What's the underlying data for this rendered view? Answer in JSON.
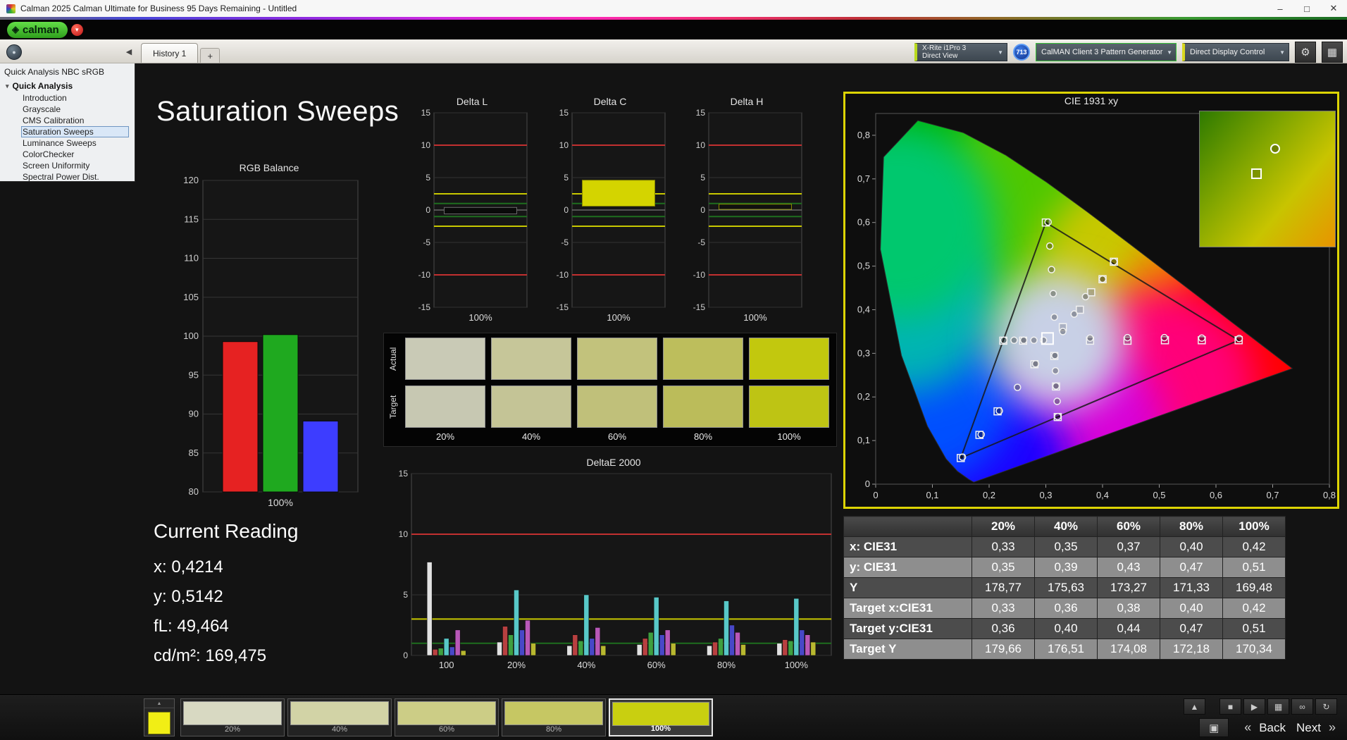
{
  "title_bar": {
    "title": "Calman 2025 Calman Ultimate for Business 95 Days Remaining  - Untitled",
    "minimize": "–",
    "maximize": "□",
    "close": "✕"
  },
  "toolbar": {
    "logo_text": "calman",
    "logo_icon": "◈",
    "logo_caret": "▾"
  },
  "tab_bar": {
    "tabs": [
      {
        "label": "History 1"
      }
    ],
    "add_tab": "+",
    "collapse_icon": "◀",
    "nav_icon": "●",
    "badge": "713",
    "devices": [
      {
        "line1": "X-Rite i1Pro 3",
        "line2": "Direct View"
      },
      {
        "line1": "CalMAN Client 3 Pattern Generator",
        "line2": ""
      },
      {
        "line1": "Direct Display Control",
        "line2": ""
      }
    ],
    "caret": "▼",
    "gear_icon": "⚙",
    "grid_icon": "▦"
  },
  "sidebar": {
    "header": "Quick Analysis NBC sRGB",
    "root": "Quick Analysis",
    "selected_index": 3,
    "items": [
      {
        "label": "Introduction"
      },
      {
        "label": "Grayscale"
      },
      {
        "label": "CMS Calibration"
      },
      {
        "label": "Saturation Sweeps"
      },
      {
        "label": "Luminance Sweeps"
      },
      {
        "label": "ColorChecker"
      },
      {
        "label": "Screen Uniformity"
      },
      {
        "label": "Spectral Power Dist."
      }
    ]
  },
  "page_title": "Saturation Sweeps",
  "current_reading": {
    "title": "Current Reading",
    "lines": [
      "x: 0,4214",
      "y: 0,5142",
      "fL: 49,464",
      "cd/m²: 169,475"
    ]
  },
  "swatch_panel": {
    "row_labels": [
      "Actual",
      "Target"
    ],
    "col_labels": [
      "20%",
      "40%",
      "60%",
      "80%",
      "100%"
    ],
    "actual": [
      "#c9cab6",
      "#c6c699",
      "#c2c27c",
      "#bdbe5c",
      "#c2c80e"
    ],
    "target": [
      "#c7c8b2",
      "#c4c496",
      "#c0c07a",
      "#bbbc5a",
      "#bec414"
    ]
  },
  "chart_data": {
    "rgb_balance": {
      "type": "bar",
      "title": "RGB Balance",
      "categories": [
        "Red",
        "Green",
        "Blue"
      ],
      "values": [
        99.3,
        100.2,
        89.1
      ],
      "colors": [
        "#e62222",
        "#1fa91f",
        "#3d3dff"
      ],
      "ylim": [
        80,
        120
      ],
      "ytick": 5,
      "xlabel": "100%"
    },
    "delta_l": {
      "type": "range-bar",
      "title": "Delta L",
      "ylim": [
        -15,
        15
      ],
      "ytick": 5,
      "xlabel": "100%",
      "bar": {
        "from": -0.6,
        "to": 0.4,
        "color": "#0a0a0a",
        "stroke": "#6a6a6a"
      },
      "ref_lines": [
        {
          "y": 10,
          "color": "#c23030"
        },
        {
          "y": -10,
          "color": "#c23030"
        },
        {
          "y": 2.5,
          "color": "#c8c800"
        },
        {
          "y": -2.5,
          "color": "#c8c800"
        },
        {
          "y": 1,
          "color": "#1e6e1e"
        },
        {
          "y": -1,
          "color": "#1e6e1e"
        }
      ]
    },
    "delta_c": {
      "type": "range-bar",
      "title": "Delta C",
      "ylim": [
        -15,
        15
      ],
      "ytick": 5,
      "xlabel": "100%",
      "bar": {
        "from": 0.6,
        "to": 4.6,
        "color": "#d4d400",
        "stroke": "#8a8a00"
      },
      "ref_lines": [
        {
          "y": 10,
          "color": "#c23030"
        },
        {
          "y": -10,
          "color": "#c23030"
        },
        {
          "y": 2.5,
          "color": "#c8c800"
        },
        {
          "y": -2.5,
          "color": "#c8c800"
        },
        {
          "y": 1,
          "color": "#1e6e1e"
        },
        {
          "y": -1,
          "color": "#1e6e1e"
        }
      ]
    },
    "delta_h": {
      "type": "range-bar",
      "title": "Delta H",
      "ylim": [
        -15,
        15
      ],
      "ytick": 5,
      "xlabel": "100%",
      "bar": {
        "from": 0.1,
        "to": 0.9,
        "color": "#101010",
        "stroke": "#8a8a00"
      },
      "ref_lines": [
        {
          "y": 10,
          "color": "#c23030"
        },
        {
          "y": -10,
          "color": "#c23030"
        },
        {
          "y": 2.5,
          "color": "#c8c800"
        },
        {
          "y": -2.5,
          "color": "#c8c800"
        },
        {
          "y": 1,
          "color": "#1e6e1e"
        },
        {
          "y": -1,
          "color": "#1e6e1e"
        }
      ]
    },
    "deltae2000": {
      "type": "grouped-bar",
      "title": "DeltaE 2000",
      "categories": [
        "100",
        "20%",
        "40%",
        "60%",
        "80%",
        "100%"
      ],
      "ylim": [
        0,
        15
      ],
      "ytick": 5,
      "ref_lines": [
        {
          "y": 10,
          "color": "#c23030"
        },
        {
          "y": 3,
          "color": "#c8c800"
        },
        {
          "y": 1,
          "color": "#1e6e1e"
        }
      ],
      "series": [
        {
          "name": "white",
          "color": "#e2e2e2",
          "values": [
            7.7,
            1.1,
            0.8,
            0.9,
            0.8,
            1.0
          ]
        },
        {
          "name": "red",
          "color": "#b84040",
          "values": [
            0.5,
            2.4,
            1.7,
            1.4,
            1.1,
            1.3
          ]
        },
        {
          "name": "green",
          "color": "#3f9f3f",
          "values": [
            0.6,
            1.7,
            1.2,
            1.9,
            1.4,
            1.2
          ]
        },
        {
          "name": "teal",
          "color": "#58c8c8",
          "values": [
            1.4,
            5.4,
            5.0,
            4.8,
            4.5,
            4.7
          ]
        },
        {
          "name": "blue",
          "color": "#4848c8",
          "values": [
            0.7,
            2.1,
            1.4,
            1.7,
            2.5,
            2.1
          ]
        },
        {
          "name": "magenta",
          "color": "#b858b8",
          "values": [
            2.1,
            2.9,
            2.3,
            2.1,
            1.9,
            1.7
          ]
        },
        {
          "name": "yellow",
          "color": "#b8b830",
          "values": [
            0.4,
            1.0,
            0.8,
            1.0,
            0.9,
            1.1
          ]
        }
      ]
    },
    "cie": {
      "type": "scatter",
      "title": "CIE 1931 xy",
      "xlim": [
        0,
        0.8
      ],
      "ylim": [
        0,
        0.85
      ],
      "gamut_triangle": [
        [
          0.64,
          0.33
        ],
        [
          0.3,
          0.6
        ],
        [
          0.15,
          0.06
        ]
      ],
      "current_point": [
        0.303,
        0.334
      ],
      "measured_points": [
        [
          0.378,
          0.335
        ],
        [
          0.444,
          0.336
        ],
        [
          0.509,
          0.336
        ],
        [
          0.575,
          0.335
        ],
        [
          0.641,
          0.334
        ],
        [
          0.315,
          0.383
        ],
        [
          0.313,
          0.437
        ],
        [
          0.31,
          0.492
        ],
        [
          0.307,
          0.546
        ],
        [
          0.304,
          0.601
        ],
        [
          0.282,
          0.276
        ],
        [
          0.25,
          0.222
        ],
        [
          0.218,
          0.168
        ],
        [
          0.186,
          0.114
        ],
        [
          0.153,
          0.062
        ],
        [
          0.33,
          0.35
        ],
        [
          0.35,
          0.39
        ],
        [
          0.37,
          0.43
        ],
        [
          0.4,
          0.47
        ],
        [
          0.42,
          0.51
        ],
        [
          0.296,
          0.33
        ],
        [
          0.279,
          0.33
        ],
        [
          0.261,
          0.33
        ],
        [
          0.244,
          0.33
        ],
        [
          0.226,
          0.33
        ],
        [
          0.316,
          0.295
        ],
        [
          0.317,
          0.26
        ],
        [
          0.318,
          0.225
        ],
        [
          0.32,
          0.19
        ],
        [
          0.321,
          0.155
        ]
      ],
      "target_points": [
        [
          0.378,
          0.329
        ],
        [
          0.444,
          0.329
        ],
        [
          0.51,
          0.33
        ],
        [
          0.575,
          0.33
        ],
        [
          0.64,
          0.33
        ],
        [
          0.3,
          0.6
        ],
        [
          0.28,
          0.275
        ],
        [
          0.215,
          0.167
        ],
        [
          0.183,
          0.113
        ],
        [
          0.15,
          0.06
        ],
        [
          0.33,
          0.36
        ],
        [
          0.36,
          0.4
        ],
        [
          0.38,
          0.44
        ],
        [
          0.4,
          0.47
        ],
        [
          0.42,
          0.51
        ],
        [
          0.315,
          0.294
        ],
        [
          0.318,
          0.224
        ],
        [
          0.321,
          0.154
        ],
        [
          0.26,
          0.329
        ],
        [
          0.225,
          0.329
        ]
      ]
    }
  },
  "table": {
    "headers": [
      "",
      "20%",
      "40%",
      "60%",
      "80%",
      "100%"
    ],
    "rows": [
      {
        "label": "x: CIE31",
        "values": [
          "0,33",
          "0,35",
          "0,37",
          "0,40",
          "0,42"
        ]
      },
      {
        "label": "y: CIE31",
        "values": [
          "0,35",
          "0,39",
          "0,43",
          "0,47",
          "0,51"
        ]
      },
      {
        "label": "Y",
        "values": [
          "178,77",
          "175,63",
          "173,27",
          "171,33",
          "169,48"
        ]
      },
      {
        "label": "Target x:CIE31",
        "values": [
          "0,33",
          "0,36",
          "0,38",
          "0,40",
          "0,42"
        ]
      },
      {
        "label": "Target y:CIE31",
        "values": [
          "0,36",
          "0,40",
          "0,44",
          "0,47",
          "0,51"
        ]
      },
      {
        "label": "Target Y",
        "values": [
          "179,66",
          "176,51",
          "174,08",
          "172,18",
          "170,34"
        ]
      }
    ]
  },
  "bottom_bar": {
    "indicator_color": "#f1ee15",
    "swatches": [
      {
        "label": "20%",
        "color": "#d8d9c2",
        "selected": false
      },
      {
        "label": "40%",
        "color": "#d2d3a6",
        "selected": false
      },
      {
        "label": "60%",
        "color": "#cccd86",
        "selected": false
      },
      {
        "label": "80%",
        "color": "#c6c763",
        "selected": false
      },
      {
        "label": "100%",
        "color": "#c9cf10",
        "selected": true
      }
    ],
    "controls": {
      "eject": "▲",
      "stop": "■",
      "play": "▶",
      "save": "▦",
      "loop": "∞",
      "refresh": "↻",
      "stop_large": "▣",
      "back_chevron": "«",
      "back": "Back",
      "next": "Next",
      "next_chevron": "»"
    }
  }
}
